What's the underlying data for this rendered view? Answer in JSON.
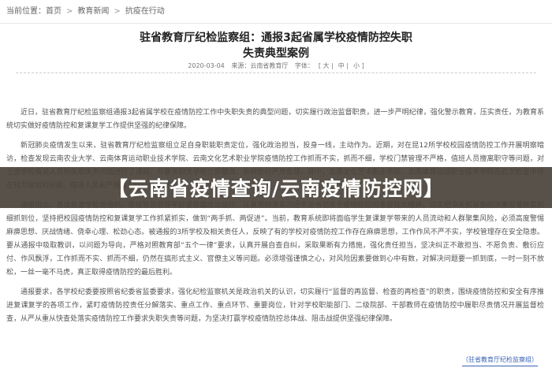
{
  "breadcrumb": {
    "items": [
      "当前位置：",
      "首页",
      "教育新闻",
      "抗疫在行动"
    ],
    "separator": ">"
  },
  "article": {
    "title_line1": "驻省教育厅纪检监察组：通报3起省属学校疫情防控失职",
    "title_line2": "失责典型案例",
    "meta": {
      "date": "2020-03-04",
      "source_label": "来源：云南省教育厅",
      "font_label": "字体：",
      "font_big": "[ 大 |",
      "font_mid": "中 |",
      "font_small": "小 ]"
    },
    "paragraphs": [
      "近日，驻省教育厅纪检监察组通报3起省属学校在疫情防控工作中失职失责的典型问题，切实履行政治监督职责，进一步严明纪律，强化警示教育，压实责任，为教育系统切实做好疫情防控和复课复学工作提供坚强的纪律保障。",
      "新冠肺炎疫情发生以来，驻省教育厅纪检监察组立足自身职能职责定位，强化政治担当，投身一线，主动作为。近期，对在昆12所学校校园疫情防控工作开展明察暗访，检查发现云南农业大学、云南体育运动职业技术学院、云南文化艺术职业学院疫情防控工作抓而不实，抓而不细，学校门禁管理不严格，值班人员擅离职守等问题，对上述学校有关人员的失职失责问题进行了通报，并要求相关学校立即整改，依规依纪严肃处理。其中，云南文化艺术职业学院、云南体育运动职业技术学院在此次检查中存在较为突出的问题。值班人员未严格落实值班值守要求。",
      "通报指出，各级各类学校党组织、各级党员领导干部要提高政治站位，认真贯彻落实习近平总书记关于疫情防控的重要批示精神，切实把中央和省委的决策部署抓实抓细抓到位，坚持把校园疫情防控和复课复学工作抓紧抓实，做到“两手抓、两促进”。当前，教育系统即将面临学生复课复学带来的人员流动和人群聚集风险，必须高度警惕麻痹思想、厌战情绪、侥幸心理、松劲心态。被通报的3所学校及相关责任人，反映了有的学校对疫情防控工作存在麻痹思想，工作作风不严不实，学校管理存在安全隐患。要从通报中吸取教训，以问题为导向，严格对照教育部“五个一律”要求，认真开展自查自纠，采取果断有力措施，强化责任担当，坚决纠正不敢担当、不愿负责、敷衍应付、作风飘浮，工作抓而不实、抓而不细，仍然在搞形式主义、官僚主义等问题。必须增强谨慎之心，对风险因素要做到心中有数，对解决问题要一抓到底，一时一刻不放松，一丝一毫不马虎，真正取得疫情防控的最后胜利。",
      "通报要求，各学校纪委要按照省纪委省监委要求，强化纪检监察机关是政治机关的认识，切实履行“监督的再监督、检查的再检查”的职责，围绕疫情防控和安全有序推进复课复学的各项工作，紧盯疫情防控责任分解落实、重点工作、重点环节、重要岗位，针对学校职能部门、二级院部、干部教师在疫情防控中履职尽责情况开展监督检查，从严从重从快查处落实疫情防控工作要求失职失责等问题，为坚决打赢学校疫情防控总体战、阻击战提供坚强纪律保障。"
    ],
    "source_link": "（驻省教育厅纪检监察组）"
  },
  "overlay_banner": "【云南省疫情查询/云南疫情防控网】"
}
